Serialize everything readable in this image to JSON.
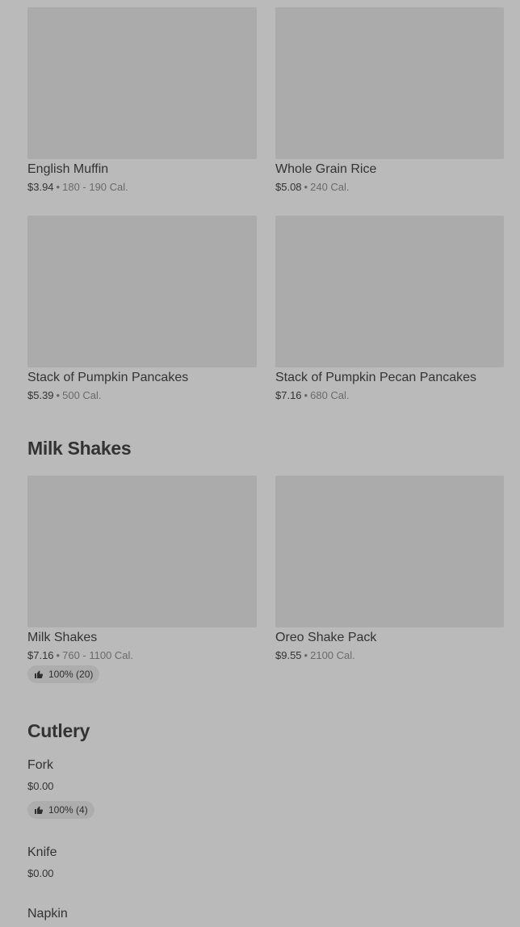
{
  "breakfast_items": [
    {
      "name": "English Muffin",
      "price": "$3.94",
      "calories": "180 - 190 Cal."
    },
    {
      "name": "Whole Grain Rice",
      "price": "$5.08",
      "calories": "240 Cal."
    },
    {
      "name": "Stack of Pumpkin Pancakes",
      "price": "$5.39",
      "calories": "500 Cal."
    },
    {
      "name": "Stack of Pumpkin Pecan Pancakes",
      "price": "$7.16",
      "calories": "680 Cal."
    }
  ],
  "milk_shakes": {
    "title": "Milk Shakes",
    "items": [
      {
        "name": "Milk Shakes",
        "price": "$7.16",
        "calories": "760 - 1100 Cal.",
        "rating": "100% (20)"
      },
      {
        "name": "Oreo Shake Pack",
        "price": "$9.55",
        "calories": "2100 Cal."
      }
    ]
  },
  "cutlery": {
    "title": "Cutlery",
    "items": [
      {
        "name": "Fork",
        "price": "$0.00",
        "rating": "100% (4)"
      },
      {
        "name": "Knife",
        "price": "$0.00"
      },
      {
        "name": "Napkin"
      }
    ]
  },
  "separator": "•",
  "icons": {
    "rating": "thumbs-up-icon"
  }
}
